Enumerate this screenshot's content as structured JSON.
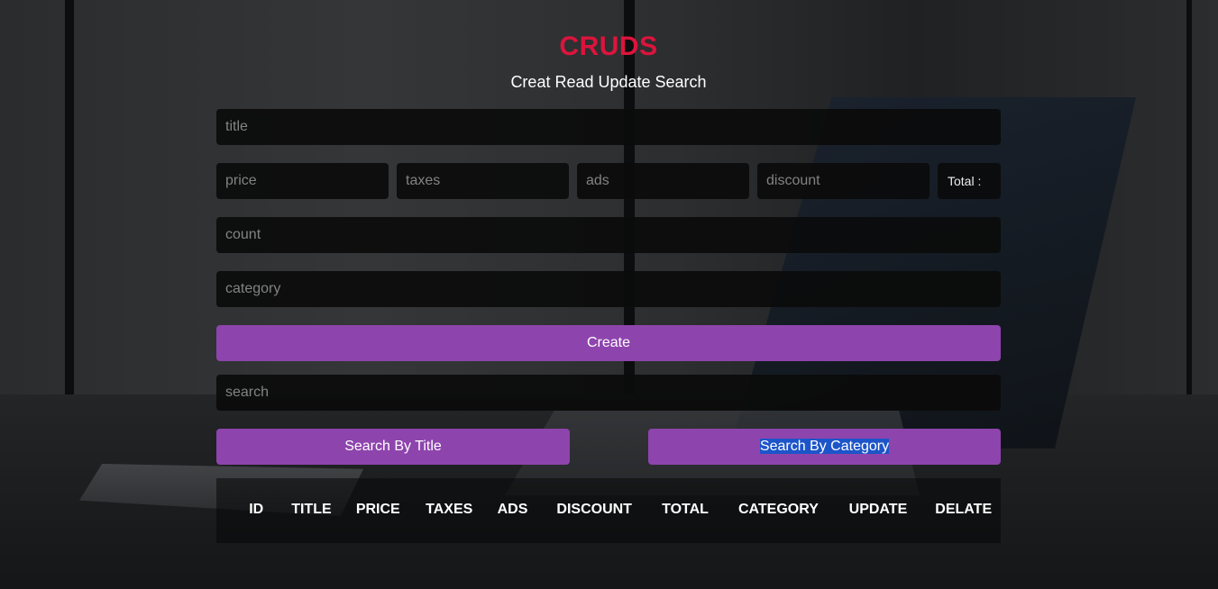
{
  "header": {
    "title": "CRUDS",
    "subtitle": "Creat Read Update Search"
  },
  "form": {
    "title_placeholder": "title",
    "price_placeholder": "price",
    "taxes_placeholder": "taxes",
    "ads_placeholder": "ads",
    "discount_placeholder": "discount",
    "total_label": "Total :",
    "count_placeholder": "count",
    "category_placeholder": "category",
    "create_label": "Create"
  },
  "search": {
    "placeholder": "search",
    "by_title_label": "Search By Title",
    "by_category_label": "Search By Category"
  },
  "table": {
    "headers": [
      "ID",
      "TITLE",
      "PRICE",
      "TAXES",
      "ADS",
      "DISCOUNT",
      "TOTAL",
      "CATEGORY",
      "UPDATE",
      "DELATE"
    ]
  },
  "colors": {
    "title": "#dc143c",
    "button": "#8e44ad",
    "input_bg": "#0b0b0b",
    "selection": "#1d55c9"
  }
}
